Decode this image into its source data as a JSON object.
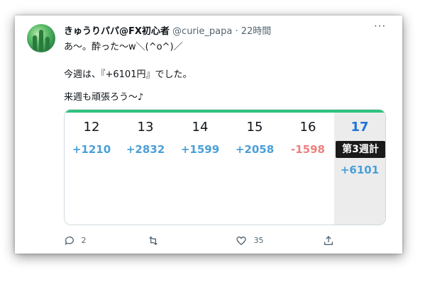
{
  "tweet": {
    "display_name": "きゅうりパパ@FX初心者",
    "handle": "@curie_papa",
    "separator": "·",
    "time": "22時間",
    "lines": [
      "あ〜。酔った〜w＼(^o^)／",
      "今週は、『+6101円』でした。",
      "来週も頑張ろう〜♪"
    ]
  },
  "table": {
    "columns": [
      {
        "day": "12",
        "value": "+1210"
      },
      {
        "day": "13",
        "value": "+2832"
      },
      {
        "day": "14",
        "value": "+1599"
      },
      {
        "day": "15",
        "value": "+2058"
      },
      {
        "day": "16",
        "value": "-1598"
      },
      {
        "day": "17",
        "badge": "第3週計",
        "total": "+6101"
      }
    ]
  },
  "actions": {
    "reply_count": "2",
    "retweet_count": "",
    "like_count": "35"
  },
  "colors": {
    "positive": "#4a9fd8",
    "negative": "#ee7f7f",
    "accent_bar": "#2ec27e",
    "highlight_day": "#1d74d8"
  }
}
